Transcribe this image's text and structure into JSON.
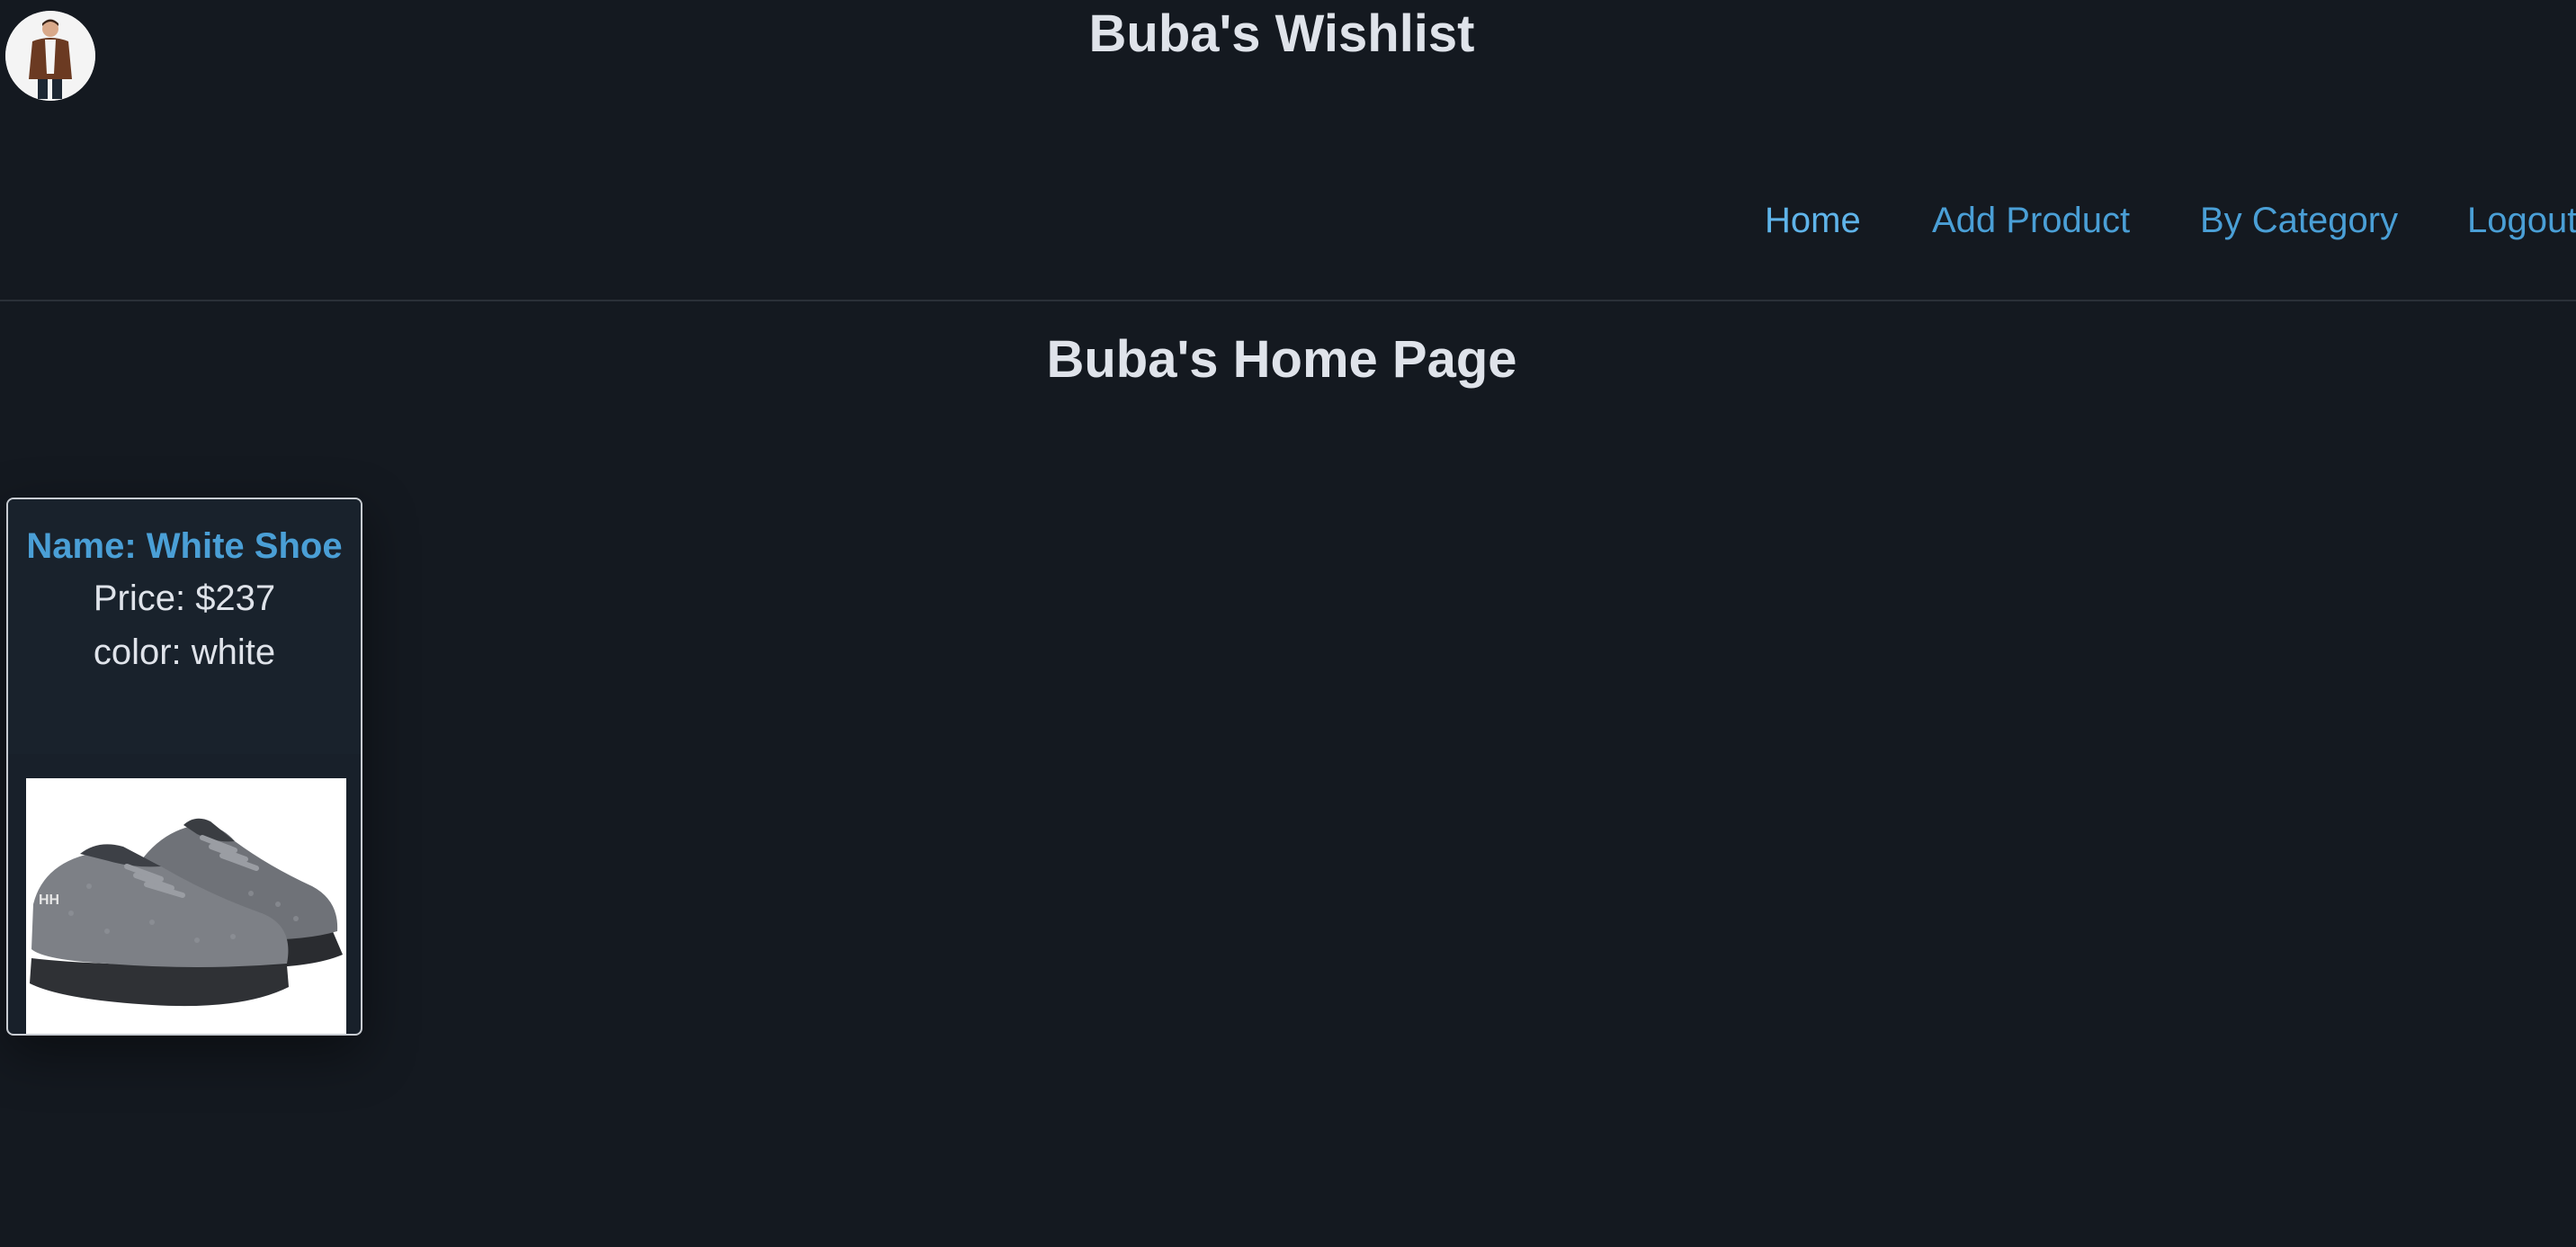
{
  "header": {
    "title": "Buba's Wishlist",
    "avatar_icon": "user-avatar-photo"
  },
  "nav": {
    "items": [
      {
        "label": "Home",
        "active": true
      },
      {
        "label": "Add Product",
        "active": false
      },
      {
        "label": "By Category",
        "active": false
      },
      {
        "label": "Logout",
        "active": false
      }
    ]
  },
  "main": {
    "page_title": "Buba's Home Page",
    "products": [
      {
        "name": "Name: White Shoe",
        "price": "Price: $237",
        "color": "color: white",
        "image_icon": "sneaker-photo"
      }
    ]
  },
  "colors": {
    "background": "#141920",
    "link": "#4a9fd6",
    "text": "#dfe3ea",
    "card_border": "#c8ccd2"
  }
}
